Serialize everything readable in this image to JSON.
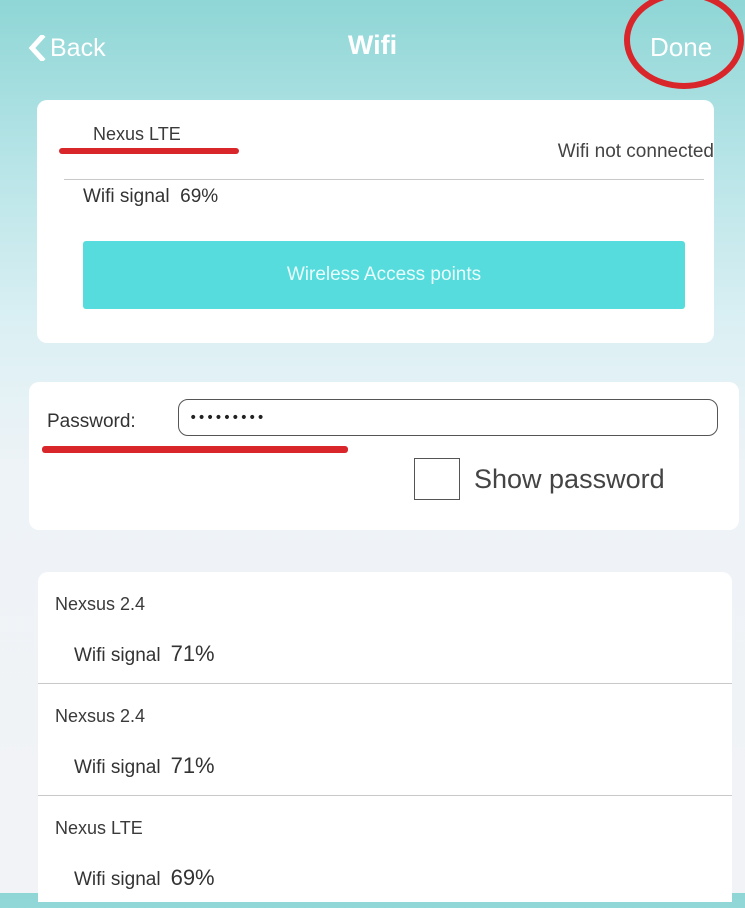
{
  "header": {
    "back_label": "Back",
    "title": "Wifi",
    "done_label": "Done"
  },
  "current_network": {
    "name": "Nexus LTE",
    "status": "Wifi not connected",
    "signal_label": "Wifi signal",
    "signal_value": "69%",
    "access_points_button": "Wireless Access points"
  },
  "password": {
    "label": "Password:",
    "value": "•••••••••",
    "show_label": "Show password",
    "show_checked": false
  },
  "access_points": [
    {
      "name": "Nexsus 2.4",
      "signal_label": "Wifi signal",
      "signal_value": "71%"
    },
    {
      "name": "Nexsus 2.4",
      "signal_label": "Wifi signal",
      "signal_value": "71%"
    },
    {
      "name": "Nexus LTE",
      "signal_label": "Wifi signal",
      "signal_value": "69%"
    }
  ],
  "colors": {
    "header_teal": "#8fd6d6",
    "button_cyan": "#56dcdc",
    "annotation_red": "#d8262a"
  },
  "icons": {
    "back": "chevron-left-icon"
  }
}
